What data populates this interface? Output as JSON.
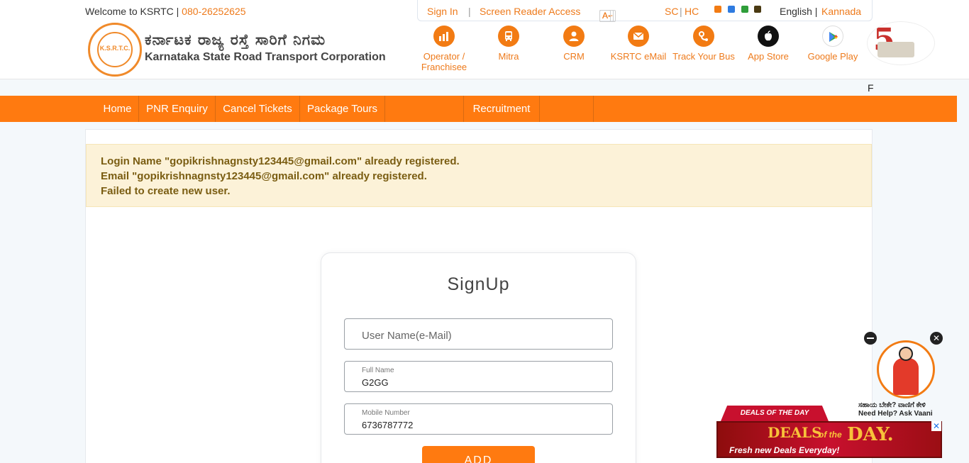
{
  "header": {
    "welcome_text": "Welcome to KSRTC |",
    "phone": "080-26252625",
    "logo_text_kn": "ಕರ್ನಾಟಕ ರಾಜ್ಯ ರಸ್ತೆ ಸಾರಿಗೆ ನಿಗಮ",
    "logo_text_en": "Karnataka State Road Transport Corporation",
    "logo_glyph": "K.S.R.T.C."
  },
  "util_bar": {
    "sign_in": "Sign In",
    "sep": "|",
    "screen_reader": "Screen Reader Access",
    "font_increase": "A+",
    "font_normal": "A",
    "font_decrease": "A-",
    "sc": "SC",
    "hc": "HC",
    "theme_colors": [
      "#f27b13",
      "#2f7be0",
      "#2f9e3a",
      "#4a3a12"
    ],
    "lang_en": "English |",
    "lang_kn": "Kannada"
  },
  "quick_links": [
    {
      "label": "Operator / Franchisee",
      "icon": "operator-icon"
    },
    {
      "label": "Mitra",
      "icon": "bus-icon"
    },
    {
      "label": "CRM",
      "icon": "user-icon"
    },
    {
      "label": "KSRTC eMail",
      "icon": "mail-icon"
    },
    {
      "label": "Track Your Bus",
      "icon": "track-icon"
    },
    {
      "label": "App Store",
      "icon": "apple-icon"
    },
    {
      "label": "Google Play",
      "icon": "google-play-icon"
    }
  ],
  "marquee": {
    "text": "F"
  },
  "nav": {
    "items": [
      "Home",
      "PNR Enquiry",
      "Cancel Tickets",
      "Package Tours",
      "",
      "Recruitment",
      ""
    ]
  },
  "alert": {
    "line1": "Login Name \"gopikrishnagnsty123445@gmail.com\" already registered.",
    "line2": "Email \"gopikrishnagnsty123445@gmail.com\" already registered.",
    "line3": "Failed to create new user."
  },
  "signup": {
    "title": "SignUp",
    "username_placeholder": "User Name(e-Mail)",
    "fullname_label": "Full Name",
    "fullname_value": "G2GG",
    "mobile_label": "Mobile Number",
    "mobile_value": "6736787772",
    "add_button": "ADD"
  },
  "vaani": {
    "text_kn": "ಸಹಾಯ ಬೇಕೇ? ವಾಣಿಗೆ ಕೇಳಿ",
    "text_en": "Need Help? Ask Vaani",
    "close": "✕"
  },
  "ad": {
    "ribbon": "DEALS OF THE DAY",
    "deals": "DEALS",
    "of": "of the",
    "day": "DAY.",
    "tagline": "Fresh new Deals Everyday!",
    "close": "✕"
  }
}
